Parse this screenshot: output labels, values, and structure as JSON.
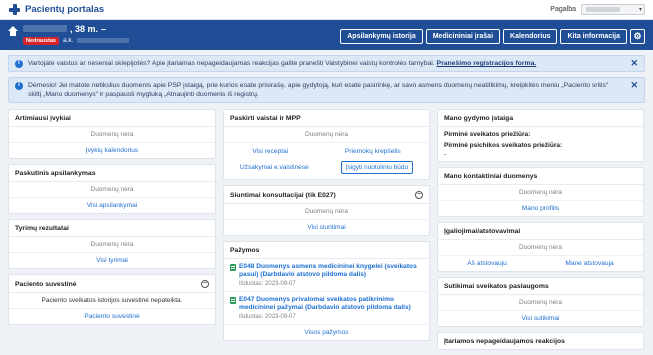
{
  "app": {
    "title": "Pacientų portalas"
  },
  "topbar": {
    "help_label": "Pagalba"
  },
  "patient": {
    "age": ", 38 m.",
    "dash": "–",
    "badge": "Nedraustas",
    "ak_label": "a.k."
  },
  "nav": [
    "Apsilankymų istorija",
    "Medicininiai įrašai",
    "Kalendorius",
    "Kita informacija"
  ],
  "alerts": {
    "first": {
      "text": "Vartojate vaistus ar neseniai skiepijotės? Apie įtariamas nepageidaujamas reakcijas galite pranešti Valstybinei vaistų kontrolės tarnybai.",
      "link": "Pranešimo registracijos forma."
    },
    "second": {
      "text": "Dėmesio! Jei matote netikslius duomenis apie PSP įstaigą, prie kurios esate prisirašę, apie gydytoją, kuri esate pasirinkę, ar savo asmens duomenų neatitikimų, kreipkitės meniu „Paciento sritis“ skiltį „Mano duomenys“ ir paspausti mygtuką „Atnaujinti duomenis iš registrų."
    }
  },
  "col1": {
    "upcoming": {
      "title": "Artimiausi įvykiai",
      "empty": "Duomenų nėra",
      "link": "Įvykių kalendorius"
    },
    "last_visit": {
      "title": "Paskutinis apsilankymas",
      "empty": "Duomenų nėra",
      "link": "Visi apsilankymai"
    },
    "tests": {
      "title": "Tyrimų rezultatai",
      "empty": "Duomenų nėra",
      "link": "Visi tyrimai"
    },
    "summary": {
      "title": "Paciento suvestinė",
      "text": "Paciento sveikatos istorijos suvestinė nepateikta.",
      "link": "Paciento suvestinė"
    }
  },
  "col2": {
    "prescriptions": {
      "title": "Paskirti vaistai ir MPP",
      "empty": "Duomenų nėra",
      "link_recipes": "Visi receptai",
      "link_cart": "Priemokų krepšelis",
      "link_orders": "Užsakymai e.vaistinėse",
      "btn_remote": "Įsigyti nuotoliniu būdu"
    },
    "referrals": {
      "title": "Siuntimai konsultacijai (tik E027)",
      "empty": "Duomenų nėra",
      "link": "Visi siuntimai"
    },
    "certificates": {
      "title": "Pažymos",
      "items": [
        {
          "title": "E048 Duomenys asmens medicininei knygelei (sveikatos pasui) (Darbdavio atstovo pildoma dalis)",
          "date": "Išduotas: 2023-09-07"
        },
        {
          "title": "E047 Duomenys privalomai sveikatos patikrinimo medicininei pažymai (Darbdavio atstovo pildoma dalis)",
          "date": "Išduotas: 2023-09-07"
        }
      ],
      "link": "Visos pažymos"
    }
  },
  "col3": {
    "institution": {
      "title": "Mano gydymo įstaiga",
      "primary": "Pirminė sveikatos priežiūra:",
      "psych": "Pirminė psichikos sveikatos priežiūra:",
      "psych_val": "-"
    },
    "contacts": {
      "title": "Mano kontaktiniai duomenys",
      "empty": "Duomenų nėra",
      "link": "Mano profilis"
    },
    "proxies": {
      "title": "Įgaliojimai/atstovavimai",
      "empty": "Duomenų nėra",
      "link_me": "Aš atstovauju",
      "link_others": "Mane atstovauja"
    },
    "consents": {
      "title": "Sutikimai sveikatos paslaugoms",
      "empty": "Duomenų nėra",
      "link": "Visi sutikimai"
    },
    "reactions": {
      "title": "Įtariamos nepageidaujamos reakcijos"
    }
  }
}
